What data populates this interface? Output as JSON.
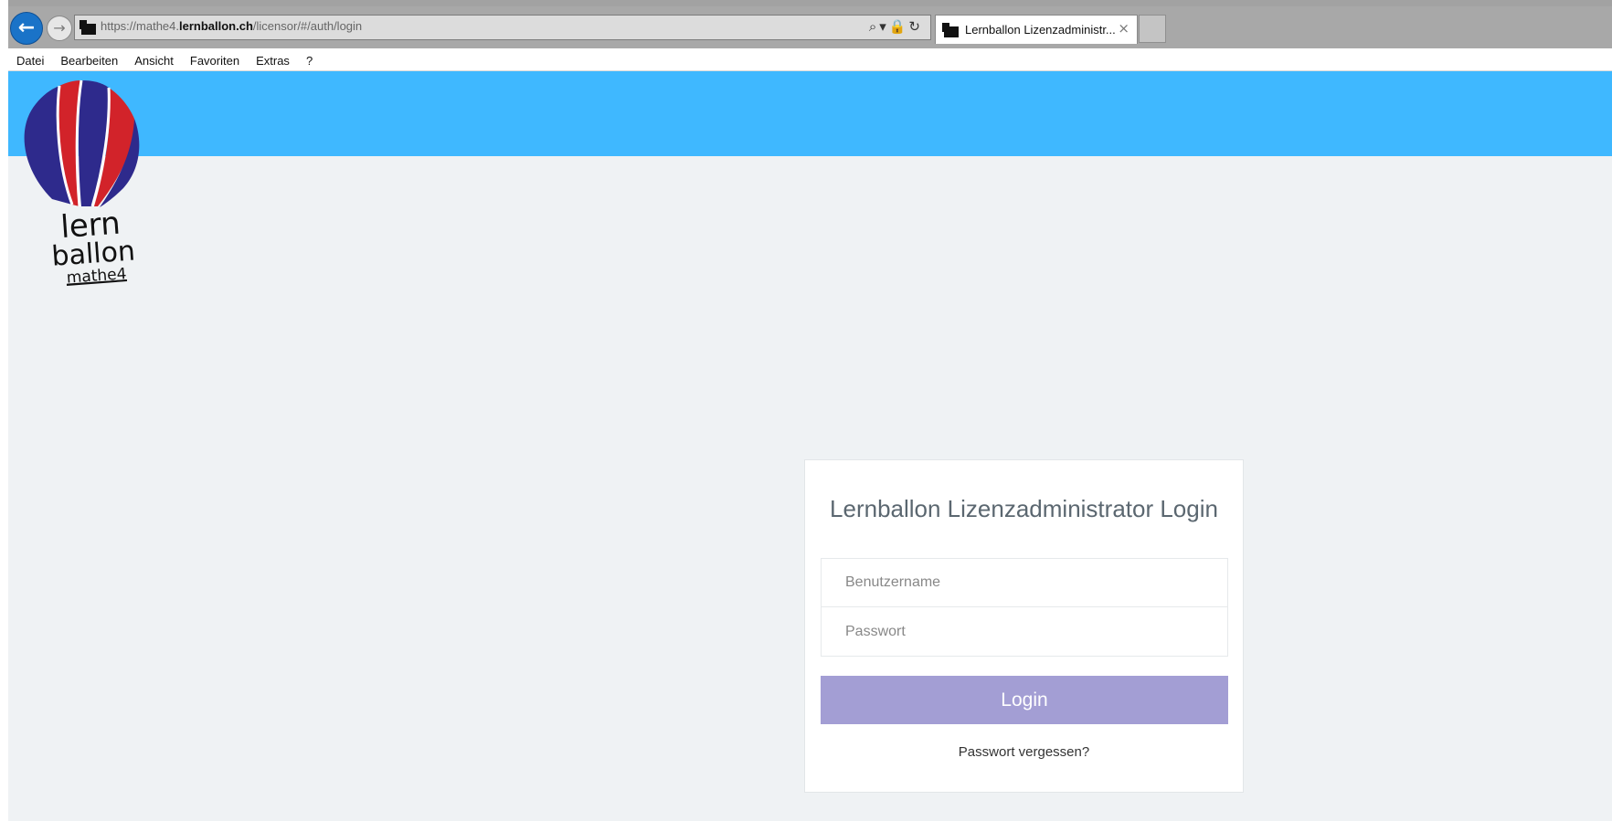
{
  "browser": {
    "url_prefix": "https://mathe4.",
    "url_domain": "lernballon.ch",
    "url_path": "/licensor/#/auth/login",
    "tab_title": "Lernballon Lizenzadministr...",
    "tab_close": "×",
    "back_glyph": "←",
    "forward_glyph": "→",
    "addr_tools": "⌕▾🔒↻",
    "menu": [
      "Datei",
      "Bearbeiten",
      "Ansicht",
      "Favoriten",
      "Extras",
      "?"
    ]
  },
  "logo": {
    "line1": "lern",
    "line2": "ballon",
    "line3": "mathe4"
  },
  "login": {
    "title": "Lernballon Lizenzadministrator Login",
    "username_placeholder": "Benutzername",
    "password_placeholder": "Passwort",
    "button_label": "Login",
    "forgot_label": "Passwort vergessen?"
  },
  "colors": {
    "header_band": "#3fb8ff",
    "page_bg": "#eff2f4",
    "button": "#a39ed4",
    "balloon_red": "#d2232a",
    "balloon_blue": "#2e2a8c"
  }
}
